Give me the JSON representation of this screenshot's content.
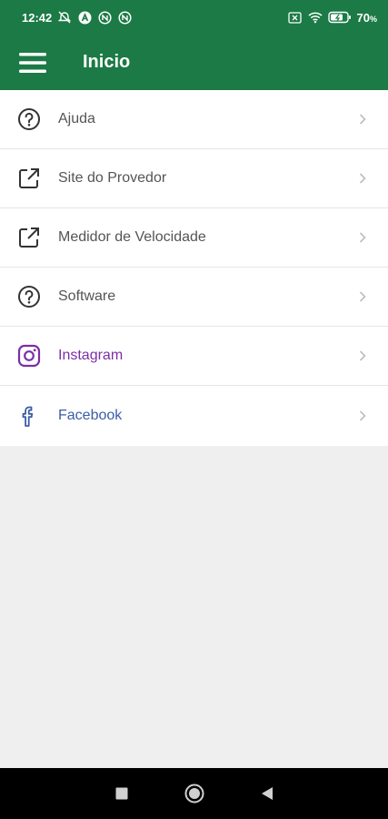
{
  "status_bar": {
    "time": "12:42",
    "battery": "70",
    "battery_unit": "%"
  },
  "app_bar": {
    "title": "Inicio",
    "menu_icon": "hamburger-menu-icon"
  },
  "menu_items": [
    {
      "label": "Ajuda",
      "icon": "help-circle-icon",
      "color": "#555555"
    },
    {
      "label": "Site do Provedor",
      "icon": "external-link-icon",
      "color": "#555555"
    },
    {
      "label": "Medidor de Velocidade",
      "icon": "external-link-icon",
      "color": "#555555"
    },
    {
      "label": "Software",
      "icon": "help-circle-icon",
      "color": "#555555"
    },
    {
      "label": "Instagram",
      "icon": "instagram-icon",
      "color": "#7b2fa6"
    },
    {
      "label": "Facebook",
      "icon": "facebook-icon",
      "color": "#3b5da8"
    }
  ],
  "colors": {
    "primary": "#1b7a45",
    "background": "#efefef"
  }
}
